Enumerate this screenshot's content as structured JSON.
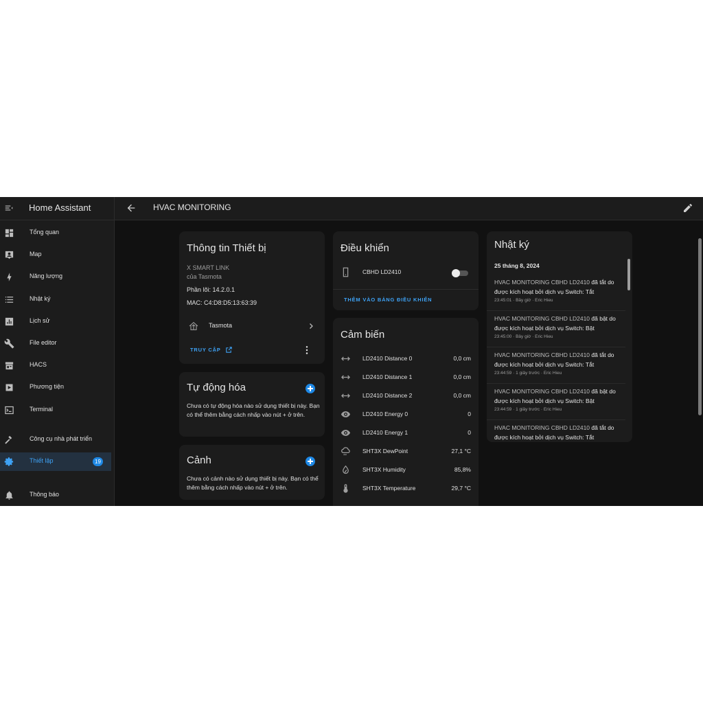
{
  "app": {
    "title": "Home Assistant"
  },
  "sidebar": {
    "items": [
      {
        "label": "Tổng quan",
        "icon": "dashboard-icon"
      },
      {
        "label": "Map",
        "icon": "map-account-icon"
      },
      {
        "label": "Năng lượng",
        "icon": "lightning-bolt-icon"
      },
      {
        "label": "Nhật ký",
        "icon": "format-list-bulleted-icon"
      },
      {
        "label": "Lịch sử",
        "icon": "chart-box-icon"
      },
      {
        "label": "File editor",
        "icon": "wrench-icon"
      },
      {
        "label": "HACS",
        "icon": "hacs-store-icon"
      },
      {
        "label": "Phương tiện",
        "icon": "play-box-icon"
      },
      {
        "label": "Terminal",
        "icon": "console-icon"
      },
      {
        "label": "Công cụ nhà phát triển",
        "icon": "hammer-icon"
      },
      {
        "label": "Thiết lập",
        "icon": "cog-icon",
        "badge": "19"
      },
      {
        "label": "Thông báo",
        "icon": "bell-icon"
      }
    ]
  },
  "topbar": {
    "title": "HVAC MONITORING"
  },
  "device_info": {
    "title": "Thông tin Thiết bị",
    "model": "X SMART LINK",
    "manufacturer": "của Tasmota",
    "firmware": "Phần lõi: 14.2.0.1",
    "mac": "MAC: C4:D8:D5:13:63:39",
    "integration": "Tasmota",
    "visit_label": "TRUY CẬP"
  },
  "automation": {
    "title": "Tự động hóa",
    "desc": "Chưa có tự động hóa nào sử dụng thiết bị này. Bạn có thể thêm bằng cách nhấp vào nút + ở trên."
  },
  "scenes": {
    "title": "Cảnh",
    "desc": "Chưa có cảnh nào sử dụng thiết bị này. Bạn có thể thêm bằng cách nhấp vào nút + ở trên."
  },
  "controls": {
    "title": "Điều khiển",
    "entity": "CBHD LD2410",
    "toggle_state": "off",
    "add_label": "THÊM VÀO BẢNG ĐIỀU KHIỂN"
  },
  "sensors": {
    "title": "Cảm biến",
    "items": [
      {
        "name": "LD2410 Distance 0",
        "value": "0,0 cm",
        "icon": "arrow-left-right-icon"
      },
      {
        "name": "LD2410 Distance 1",
        "value": "0,0 cm",
        "icon": "arrow-left-right-icon"
      },
      {
        "name": "LD2410 Distance 2",
        "value": "0,0 cm",
        "icon": "arrow-left-right-icon"
      },
      {
        "name": "LD2410 Energy 0",
        "value": "0",
        "icon": "eye-icon"
      },
      {
        "name": "LD2410 Energy 1",
        "value": "0",
        "icon": "eye-icon"
      },
      {
        "name": "SHT3X DewPoint",
        "value": "27,1 °C",
        "icon": "weather-rainy-icon"
      },
      {
        "name": "SHT3X Humidity",
        "value": "85,8%",
        "icon": "water-percent-icon"
      },
      {
        "name": "SHT3X Temperature",
        "value": "29,7 °C",
        "icon": "thermometer-icon"
      }
    ]
  },
  "logbook": {
    "title": "Nhật ký",
    "date": "25 tháng 8, 2024",
    "entries": [
      {
        "source": "HVAC MONITORING CBHD LD2410",
        "action": "đã tắt",
        "cause": "do được kích hoạt bởi dịch vụ Switch: Tắt",
        "meta": "23:45:01 · Bây giờ · Eric Hieu"
      },
      {
        "source": "HVAC MONITORING CBHD LD2410",
        "action": "đã bật",
        "cause": "do được kích hoạt bởi dịch vụ Switch: Bật",
        "meta": "23:45:00 · Bây giờ · Eric Hieu"
      },
      {
        "source": "HVAC MONITORING CBHD LD2410",
        "action": "đã tắt",
        "cause": "do được kích hoạt bởi dịch vụ Switch: Tắt",
        "meta": "23:44:59 · 1 giây trước · Eric Hieu"
      },
      {
        "source": "HVAC MONITORING CBHD LD2410",
        "action": "đã bật",
        "cause": "do được kích hoạt bởi dịch vụ Switch: Bật",
        "meta": "23:44:59 · 1 giây trước · Eric Hieu"
      },
      {
        "source": "HVAC MONITORING CBHD LD2410",
        "action": "đã tắt",
        "cause": "do được kích hoạt bởi dịch vụ Switch: Tắt",
        "meta": ""
      }
    ]
  },
  "colors": {
    "accent": "#3ea2f5",
    "primary": "#1e88e5",
    "card": "#1c1c1c",
    "background": "#111111"
  }
}
